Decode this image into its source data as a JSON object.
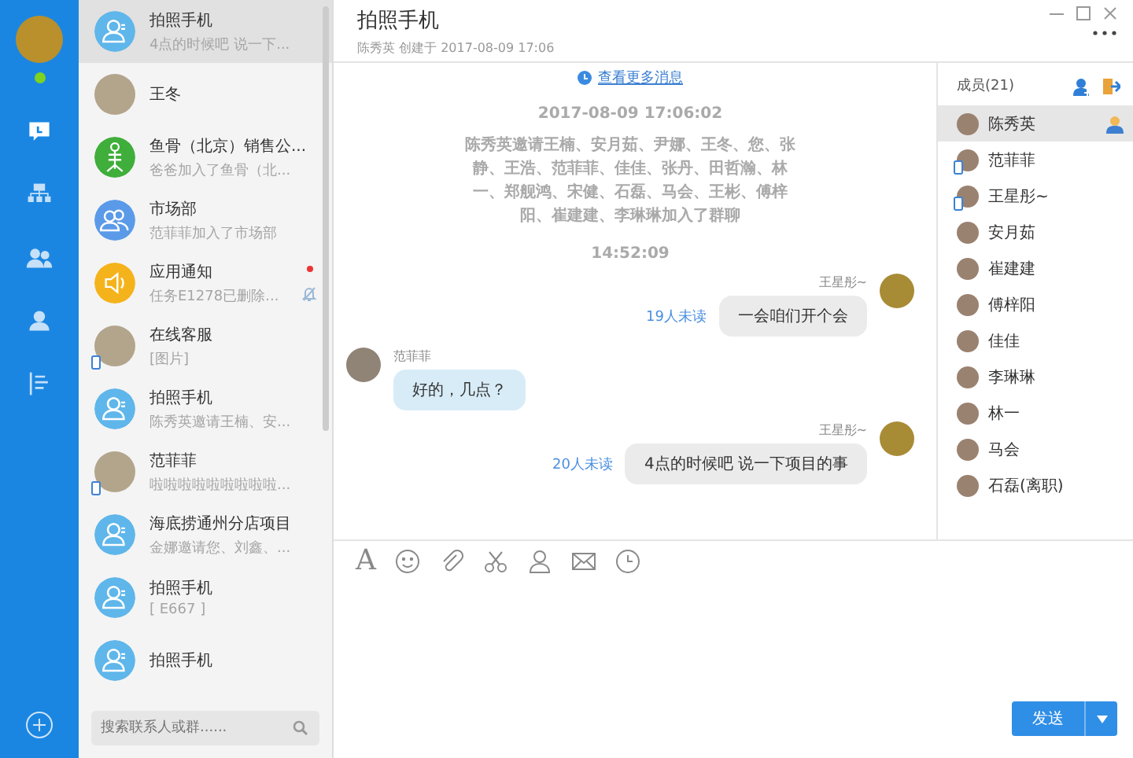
{
  "rail": {
    "online": true,
    "items": [
      {
        "kind": "chat",
        "selected": true
      },
      {
        "kind": "org",
        "selected": false
      },
      {
        "kind": "group",
        "selected": false
      },
      {
        "kind": "contact",
        "selected": false
      },
      {
        "kind": "list",
        "selected": false
      }
    ]
  },
  "conversations": [
    {
      "name": "拍照手机",
      "preview": "4点的时候吧  说一下...",
      "kind": "group",
      "selected": true,
      "mobile": false,
      "unread": false,
      "muted": false
    },
    {
      "name": "王冬",
      "kind": "photo",
      "selected": false,
      "mobile": false,
      "unread": false,
      "muted": false
    },
    {
      "name": "鱼骨（北京）销售公...",
      "preview": "爸爸加入了鱼骨（北...",
      "kind": "app",
      "selected": false,
      "mobile": false,
      "unread": false,
      "muted": false
    },
    {
      "name": "市场部",
      "preview": "范菲菲加入了市场部",
      "kind": "team",
      "selected": false,
      "mobile": false,
      "unread": false,
      "muted": false
    },
    {
      "name": "应用通知",
      "preview": "任务E1278已删除...",
      "kind": "notice",
      "selected": false,
      "mobile": false,
      "unread": true,
      "muted": true
    },
    {
      "name": "在线客服",
      "preview": "[图片]",
      "kind": "photo",
      "selected": false,
      "mobile": true,
      "unread": false,
      "muted": false
    },
    {
      "name": "拍照手机",
      "preview": "陈秀英邀请王楠、安...",
      "kind": "group",
      "selected": false,
      "mobile": false,
      "unread": false,
      "muted": false
    },
    {
      "name": "范菲菲",
      "preview": "啦啦啦啦啦啦啦啦啦...",
      "kind": "photo",
      "selected": false,
      "mobile": true,
      "unread": false,
      "muted": false
    },
    {
      "name": "海底捞通州分店项目",
      "preview": "金娜邀请您、刘鑫、...",
      "kind": "group",
      "selected": false,
      "mobile": false,
      "unread": false,
      "muted": false
    },
    {
      "name": "拍照手机",
      "preview": "[ E667 ]",
      "kind": "group",
      "selected": false,
      "mobile": false,
      "unread": false,
      "muted": false
    },
    {
      "name": "拍照手机",
      "kind": "group",
      "selected": false,
      "mobile": false,
      "unread": false,
      "muted": false
    }
  ],
  "search": {
    "placeholder": "搜索联系人或群......"
  },
  "chat": {
    "title": "拍照手机",
    "subtitle": "陈秀英 创建于 2017-08-09 17:06"
  },
  "messages": [
    {
      "kind": "link",
      "text": "查看更多消息"
    },
    {
      "kind": "time",
      "text": "2017-08-09 17:06:02"
    },
    {
      "kind": "system",
      "text": "陈秀英邀请王楠、安月茹、尹娜、王冬、您、张静、王浩、范菲菲、佳佳、张丹、田哲瀚、林一、郑舰鸿、宋健、石磊、马会、王彬、傅梓阳、崔建建、李琳琳加入了群聊"
    },
    {
      "kind": "time",
      "text": "14:52:09"
    },
    {
      "kind": "self",
      "name": "王星彤~",
      "text": "一会咱们开个会",
      "unread": "19人未读"
    },
    {
      "kind": "other",
      "name": "范菲菲",
      "text": "好的，几点？"
    },
    {
      "kind": "self",
      "name": "王星彤~",
      "text": "4点的时候吧  说一下项目的事",
      "unread": "20人未读"
    }
  ],
  "members": {
    "title": "成员(21)",
    "items": [
      {
        "name": "陈秀英",
        "selected": true,
        "owner": true,
        "mobile": false
      },
      {
        "name": "范菲菲",
        "selected": false,
        "owner": false,
        "mobile": true
      },
      {
        "name": "王星彤~",
        "selected": false,
        "owner": false,
        "mobile": true
      },
      {
        "name": "安月茹",
        "selected": false,
        "owner": false,
        "mobile": false
      },
      {
        "name": "崔建建",
        "selected": false,
        "owner": false,
        "mobile": false
      },
      {
        "name": "傅梓阳",
        "selected": false,
        "owner": false,
        "mobile": false
      },
      {
        "name": "佳佳",
        "selected": false,
        "owner": false,
        "mobile": false
      },
      {
        "name": "李琳琳",
        "selected": false,
        "owner": false,
        "mobile": false
      },
      {
        "name": "林一",
        "selected": false,
        "owner": false,
        "mobile": false
      },
      {
        "name": "马会",
        "selected": false,
        "owner": false,
        "mobile": false
      },
      {
        "name": "石磊(离职)",
        "selected": false,
        "owner": false,
        "mobile": false
      }
    ]
  },
  "toolbar": {
    "font_glyph": "A"
  },
  "send_button": {
    "label": "发送"
  }
}
